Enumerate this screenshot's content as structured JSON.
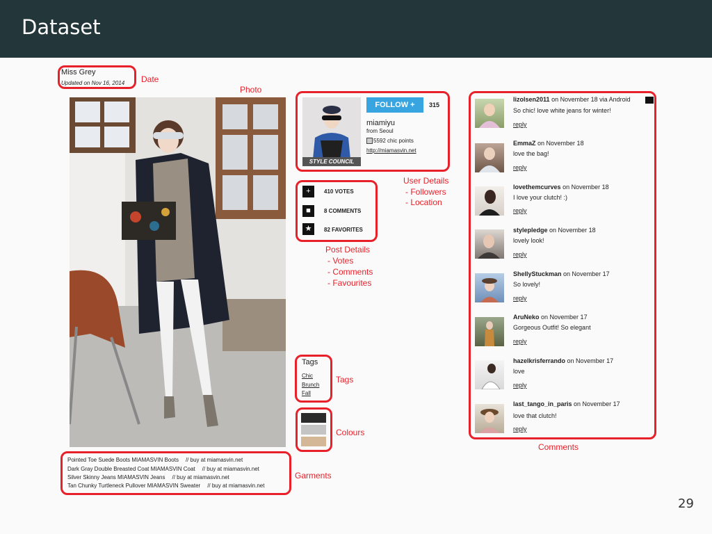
{
  "header": {
    "title": "Dataset"
  },
  "post": {
    "author": "Miss Grey",
    "updated": "Updated on Nov 16, 2014"
  },
  "user": {
    "follow_label": "FOLLOW +",
    "followers": "315",
    "username": "miamiyu",
    "location": "from Seoul",
    "chic_points": "5592 chic points",
    "url": "http://miamasvin.net",
    "badge": "STYLE COUNCIL"
  },
  "stats": [
    {
      "icon": "plus-icon",
      "label": "410 VOTES"
    },
    {
      "icon": "comment-icon",
      "label": "8 COMMENTS"
    },
    {
      "icon": "star-icon",
      "label": "82 FAVORITES"
    }
  ],
  "tags": {
    "title": "Tags",
    "items": [
      "Chic",
      "Brunch",
      "Fall"
    ]
  },
  "colours": [
    "#2b2b2b",
    "#c4c4c4",
    "#d4b796"
  ],
  "garments": [
    {
      "name": "Pointed Toe Suede Boots MIAMASVIN Boots",
      "buy": "// buy at miamasvin.net"
    },
    {
      "name": "Dark Gray Double Breasted Coat MIAMASVIN Coat",
      "buy": "// buy at miamasvin.net"
    },
    {
      "name": "Silver Skinny Jeans MIAMASVIN Jeans",
      "buy": "// buy at miamasvin.net"
    },
    {
      "name": "Tan Chunky Turtleneck Pullover MIAMASVIN Sweater",
      "buy": "// buy at miamasvin.net"
    }
  ],
  "comments": [
    {
      "user": "lizolsen2011",
      "meta": "on November 18 via Android",
      "text": "So chic! love white jeans for winter!",
      "reply": "reply"
    },
    {
      "user": "EmmaZ",
      "meta": "on November 18",
      "text": "love the bag!",
      "reply": "reply"
    },
    {
      "user": "lovethemcurves",
      "meta": "on November 18",
      "text": "I love your clutch! :)",
      "reply": "reply"
    },
    {
      "user": "stylepledge",
      "meta": "on November 18",
      "text": "lovely look!",
      "reply": "reply"
    },
    {
      "user": "ShellyStuckman",
      "meta": "on November 17",
      "text": "So lovely!",
      "reply": "reply"
    },
    {
      "user": "AruNeko",
      "meta": "on November 17",
      "text": "Gorgeous Outfit! So elegant",
      "reply": "reply"
    },
    {
      "user": "hazelkrisferrando",
      "meta": "on November 17",
      "text": "love",
      "reply": "reply"
    },
    {
      "user": "last_tango_in_paris",
      "meta": "on November 17",
      "text": "love that clutch!",
      "reply": "reply"
    }
  ],
  "annotations": {
    "date": "Date",
    "photo": "Photo",
    "user_details": [
      "User Details",
      "- Followers",
      "- Location"
    ],
    "post_details": [
      "Post Details",
      "- Votes",
      "- Comments",
      "- Favourites"
    ],
    "tags": "Tags",
    "colours": "Colours",
    "garments": "Garments",
    "comments": "Comments"
  },
  "page_number": "29"
}
